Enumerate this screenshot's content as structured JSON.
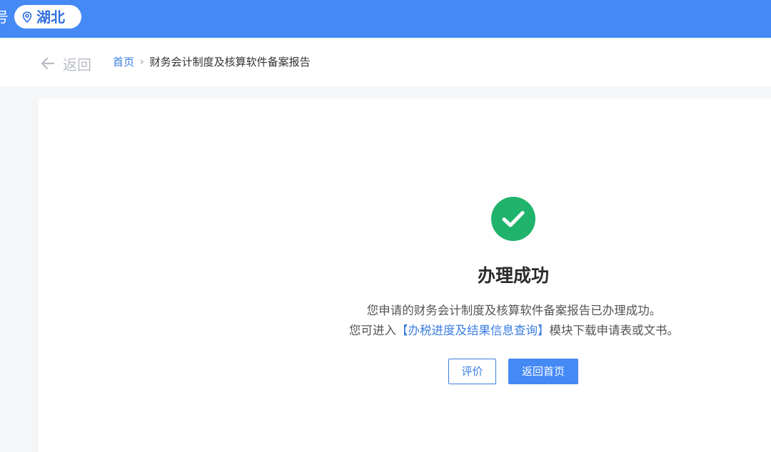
{
  "header": {
    "partial_text": "号",
    "region": "湖北",
    "region_icon": "location-pin-icon",
    "background_color": "#4589f5"
  },
  "breadcrumb": {
    "back_label": "返回",
    "back_icon": "arrow-left-icon",
    "home": "首页",
    "separator": "›",
    "current": "财务会计制度及核算软件备案报告"
  },
  "result": {
    "icon": "check-circle-icon",
    "icon_color": "#1fb36b",
    "title": "办理成功",
    "message_line1": "您申请的财务会计制度及核算软件备案报告已办理成功。",
    "message_line2_prefix": "您可进入",
    "message_line2_link": "【办税进度及结果信息查询】",
    "message_line2_suffix": "模块下载申请表或文书。",
    "link_color": "#3b7ee0"
  },
  "actions": {
    "rate_label": "评价",
    "home_label": "返回首页"
  }
}
